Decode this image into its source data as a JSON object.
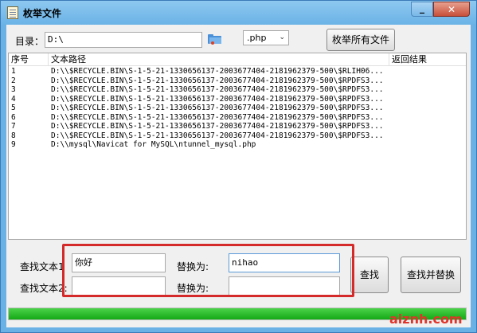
{
  "window": {
    "title": "枚举文件"
  },
  "toolbar": {
    "dir_label": "目录：",
    "dir_value": "D:\\",
    "ext_value": ".php",
    "enum_button": "枚举所有文件"
  },
  "list": {
    "columns": [
      "序号",
      "文本路径",
      "返回结果"
    ],
    "rows": [
      {
        "num": "1",
        "path": "D:\\\\$RECYCLE.BIN\\S-1-5-21-1330656137-2003677404-2181962379-500\\$RLIH06...",
        "result": ""
      },
      {
        "num": "2",
        "path": "D:\\\\$RECYCLE.BIN\\S-1-5-21-1330656137-2003677404-2181962379-500\\$RPDFS3...",
        "result": ""
      },
      {
        "num": "3",
        "path": "D:\\\\$RECYCLE.BIN\\S-1-5-21-1330656137-2003677404-2181962379-500\\$RPDFS3...",
        "result": ""
      },
      {
        "num": "4",
        "path": "D:\\\\$RECYCLE.BIN\\S-1-5-21-1330656137-2003677404-2181962379-500\\$RPDFS3...",
        "result": ""
      },
      {
        "num": "5",
        "path": "D:\\\\$RECYCLE.BIN\\S-1-5-21-1330656137-2003677404-2181962379-500\\$RPDFS3...",
        "result": ""
      },
      {
        "num": "6",
        "path": "D:\\\\$RECYCLE.BIN\\S-1-5-21-1330656137-2003677404-2181962379-500\\$RPDFS3...",
        "result": ""
      },
      {
        "num": "7",
        "path": "D:\\\\$RECYCLE.BIN\\S-1-5-21-1330656137-2003677404-2181962379-500\\$RPDFS3...",
        "result": ""
      },
      {
        "num": "8",
        "path": "D:\\\\$RECYCLE.BIN\\S-1-5-21-1330656137-2003677404-2181962379-500\\$RPDFS3...",
        "result": ""
      },
      {
        "num": "9",
        "path": "D:\\\\mysql\\Navicat for MySQL\\ntunnel_mysql.php",
        "result": ""
      }
    ]
  },
  "search": {
    "find1_label": "查找文本1",
    "find1_value": "你好",
    "replace1_label": "替换为:",
    "replace1_value": "nihao",
    "find2_label": "查找文本2:",
    "find2_value": "",
    "replace2_label": "替换为:",
    "replace2_value": "",
    "find_button": "查找",
    "replace_button": "查找并替换"
  },
  "progress": {
    "fraction": 1.0,
    "color": "#15a815"
  },
  "watermark": "aiznh.com",
  "colors": {
    "highlight": "#d42a2a",
    "titlebar": "#6ab2e6",
    "close": "#c7503a"
  }
}
